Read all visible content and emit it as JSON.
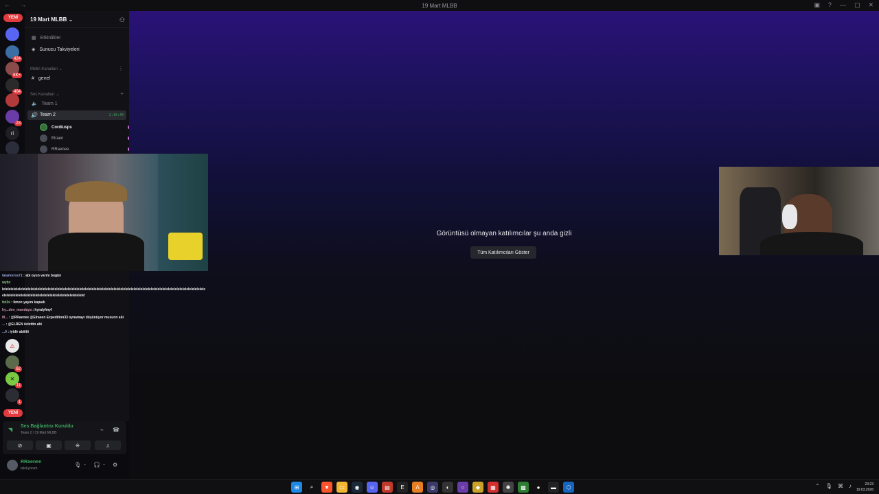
{
  "titlebar": {
    "title": "19 Mart MLBB"
  },
  "servers": {
    "yeni_top": "YENİ",
    "yeni_bottom": "YENİ",
    "badges": [
      "424",
      "8K+",
      "404",
      "23",
      "62",
      "11",
      "1"
    ],
    "ri_label": "ri"
  },
  "channels": {
    "server_name": "19 Mart MLBB ⌄",
    "events": "Etkinlikler",
    "boosts": "Sunucu Takviyeleri",
    "text_category": "Metin Kanalları ⌄",
    "text_channel": "genel",
    "voice_category": "Ses Kanalları ⌄",
    "voice_team1": "Team 1",
    "voice_team2": "Team 2",
    "voice_time": "2:10:40",
    "members": [
      "Cordiusps",
      "Elraen",
      "RRaenee"
    ]
  },
  "stage": {
    "hidden_message": "Görüntüsü olmayan katılımcılar şu anda gizli",
    "show_all_button": "Tüm Katılımcıları Göster"
  },
  "chat": [
    {
      "user": "tatarkeros71",
      "msg": " : abi oyun varmı bugün"
    },
    {
      "user": "wybc",
      "msg": ""
    },
    {
      "user": "",
      "msg": "lelelelelelelelelelelelelelelelelelelelelelelelelelelelelelelelelelelelelelelelelelelelelelelelelelelelelelelelelelelelelelelelelelelelelelele"
    },
    {
      "user": "",
      "msg": "elelelelelelelelelelelelelelelelelelelelelelelelelelelele!"
    },
    {
      "user": "fut3x",
      "msg": " : limon yayını kapadı"
    },
    {
      "user": "hy...den_mandaya",
      "msg": " : hyralyfmyf"
    },
    {
      "user": "M...",
      "msg": " : @RRaenee @Elraeen Expedition33 oynamayı düşünüyor musunn abi"
    },
    {
      "user": "...",
      "msg": " : @ELREN özlettin abi"
    },
    {
      "user": "...0",
      "msg": " : iyidir abiiiiii"
    }
  ],
  "voicebar": {
    "status": "Ses Bağlantısı Kuruldu",
    "sub": "Team 2 / 19 Mart MLBB"
  },
  "user": {
    "name": "RRaenee",
    "status": "takılıyorum"
  },
  "taskbar": {
    "time": "23:23",
    "date": "19.03.2026"
  },
  "colors": {
    "accent_green": "#3ba55d",
    "badge_red": "#e03b3f",
    "stage_top": "#2a1278"
  }
}
